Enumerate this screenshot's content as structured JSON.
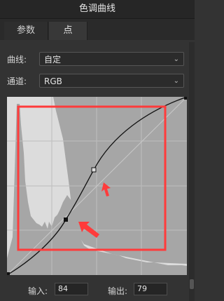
{
  "window": {
    "title": "色调曲线"
  },
  "tabs": [
    {
      "label": "参数"
    },
    {
      "label": "点"
    }
  ],
  "curve": {
    "label": "曲线:",
    "value": "自定"
  },
  "channel": {
    "label": "通道:",
    "value": "RGB"
  },
  "io": {
    "input_label": "输入:",
    "input_value": "84",
    "output_label": "输出:",
    "output_value": "79"
  },
  "annotation": {
    "box_color": "#ff3b3b",
    "arrow_color": "#ff3b3b"
  }
}
